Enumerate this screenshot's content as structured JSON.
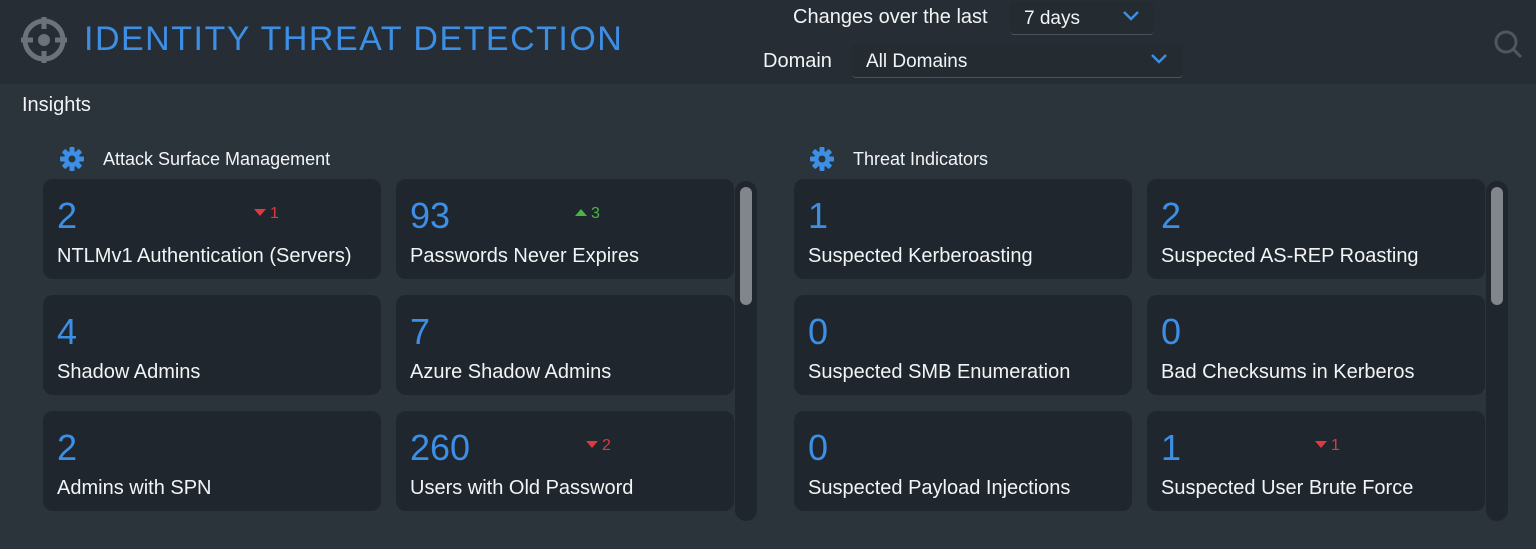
{
  "header": {
    "title": "IDENTITY THREAT DETECTION",
    "changes_label": "Changes over the last",
    "changes_value": "7 days",
    "domain_label": "Domain",
    "domain_value": "All Domains",
    "accent_color": "#3d8fe6"
  },
  "insights_label": "Insights",
  "sections": [
    {
      "title": "Attack Surface Management",
      "cards": [
        {
          "value": "2",
          "label": "NTLMv1 Authentication (Servers)",
          "delta": "1",
          "direction": "down"
        },
        {
          "value": "93",
          "label": "Passwords Never Expires",
          "delta": "3",
          "direction": "up"
        },
        {
          "value": "4",
          "label": "Shadow Admins",
          "delta": "",
          "direction": ""
        },
        {
          "value": "7",
          "label": "Azure Shadow Admins",
          "delta": "",
          "direction": ""
        },
        {
          "value": "2",
          "label": "Admins with SPN",
          "delta": "",
          "direction": ""
        },
        {
          "value": "260",
          "label": "Users with Old Password",
          "delta": "2",
          "direction": "down"
        }
      ]
    },
    {
      "title": "Threat Indicators",
      "cards": [
        {
          "value": "1",
          "label": "Suspected Kerberoasting",
          "delta": "",
          "direction": ""
        },
        {
          "value": "2",
          "label": "Suspected AS-REP Roasting",
          "delta": "",
          "direction": ""
        },
        {
          "value": "0",
          "label": "Suspected SMB Enumeration",
          "delta": "",
          "direction": ""
        },
        {
          "value": "0",
          "label": "Bad Checksums in Kerberos",
          "delta": "",
          "direction": ""
        },
        {
          "value": "0",
          "label": "Suspected Payload Injections",
          "delta": "",
          "direction": ""
        },
        {
          "value": "1",
          "label": "Suspected User Brute Force",
          "delta": "1",
          "direction": "down"
        }
      ]
    }
  ],
  "icons": {
    "logo": "crosshair-icon",
    "section_settings": "gear-icon",
    "dropdown": "chevron-down-icon",
    "search": "search-icon"
  },
  "colors": {
    "delta_down": "#e0383e",
    "delta_up": "#4bb543"
  }
}
